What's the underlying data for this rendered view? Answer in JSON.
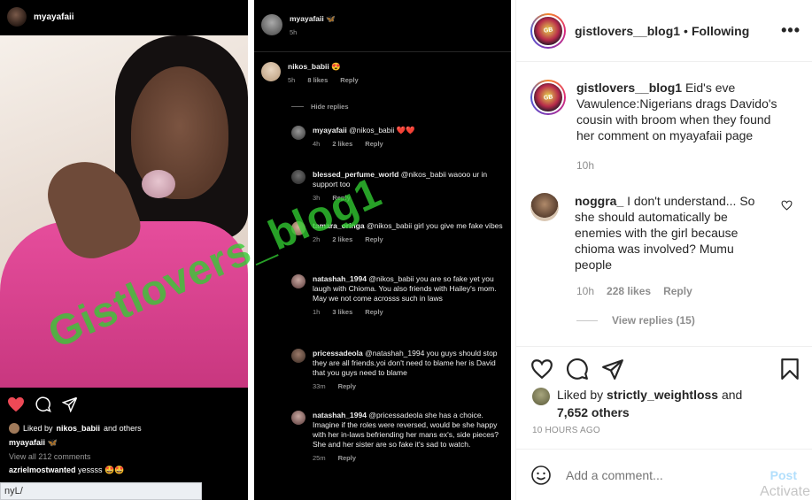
{
  "left_panel": {
    "username": "myayafaii",
    "liked_by_prefix": "Liked by",
    "liked_by_user": "nikos_babii",
    "liked_by_suffix": "and others",
    "caption_user": "myayafaii",
    "caption_emoji": "🦋",
    "view_all": "View all 212 comments",
    "comment_user": "azrielmostwanted",
    "comment_text": "yessss 🤩🤩",
    "cut_line": "...",
    "url_fragment": "nyL/"
  },
  "middle_panel": {
    "op_user": "myayafaii",
    "op_emoji": "🦋",
    "op_time": "5h",
    "comments": [
      {
        "user": "nikos_babii",
        "text": "😍",
        "time": "5h",
        "likes": "8 likes",
        "reply": "Reply"
      },
      {
        "user": "myayafaii",
        "text": "@nikos_babii ❤️❤️",
        "time": "4h",
        "likes": "2 likes",
        "reply": "Reply"
      },
      {
        "user": "blessed_perfume_world",
        "text": "@nikos_babii waooo ur in support too",
        "time": "3h",
        "likes": "",
        "reply": "Reply"
      },
      {
        "user": "tamara_oringa",
        "text": "@nikos_babii girl you  give me fake vibes",
        "time": "2h",
        "likes": "2 likes",
        "reply": "Reply"
      },
      {
        "user": "natashah_1994",
        "text": "@nikos_babii you are so fake yet you laugh with Chioma. You also friends with Hailey's mom. May we not come acrosss such in laws",
        "time": "1h",
        "likes": "3 likes",
        "reply": "Reply"
      },
      {
        "user": "pricessadeola",
        "text": "@natashah_1994 you guys should stop they are all friends.yoi don't need to blame her is David that you guys need to blame",
        "time": "33m",
        "likes": "",
        "reply": "Reply"
      },
      {
        "user": "natashah_1994",
        "text": "@pricessadeola she has a choice. Imagine if the roles were reversed, would be she happy with her in-laws befriending her mans ex's, side pieces? She and her sister are so fake it's sad to watch.",
        "time": "25m",
        "likes": "",
        "reply": "Reply"
      }
    ],
    "hide_replies": "Hide replies"
  },
  "watermark": "Gistlovers_blog1",
  "sidebar": {
    "header": {
      "username": "gistlovers__blog1",
      "separator": "•",
      "following": "Following",
      "more": "•••"
    },
    "caption": {
      "username": "gistlovers__blog1",
      "text": "Eid's eve Vawulence:Nigerians drags Davido's cousin with broom when they found her comment on myayafaii page",
      "time": "10h"
    },
    "comment": {
      "username": "noggra_",
      "text": "I don't understand... So she should automatically be enemies with the girl because chioma was involved? Mumu people",
      "time": "10h",
      "likes": "228 likes",
      "reply": "Reply",
      "view_replies": "View replies (15)"
    },
    "likes": {
      "prefix": "Liked by",
      "user": "strictly_weightloss",
      "connector": "and",
      "others": "7,652 others"
    },
    "date": "10 HOURS AGO",
    "add_comment": {
      "placeholder": "Add a comment...",
      "post": "Post"
    },
    "os_overlay": "Activate"
  }
}
